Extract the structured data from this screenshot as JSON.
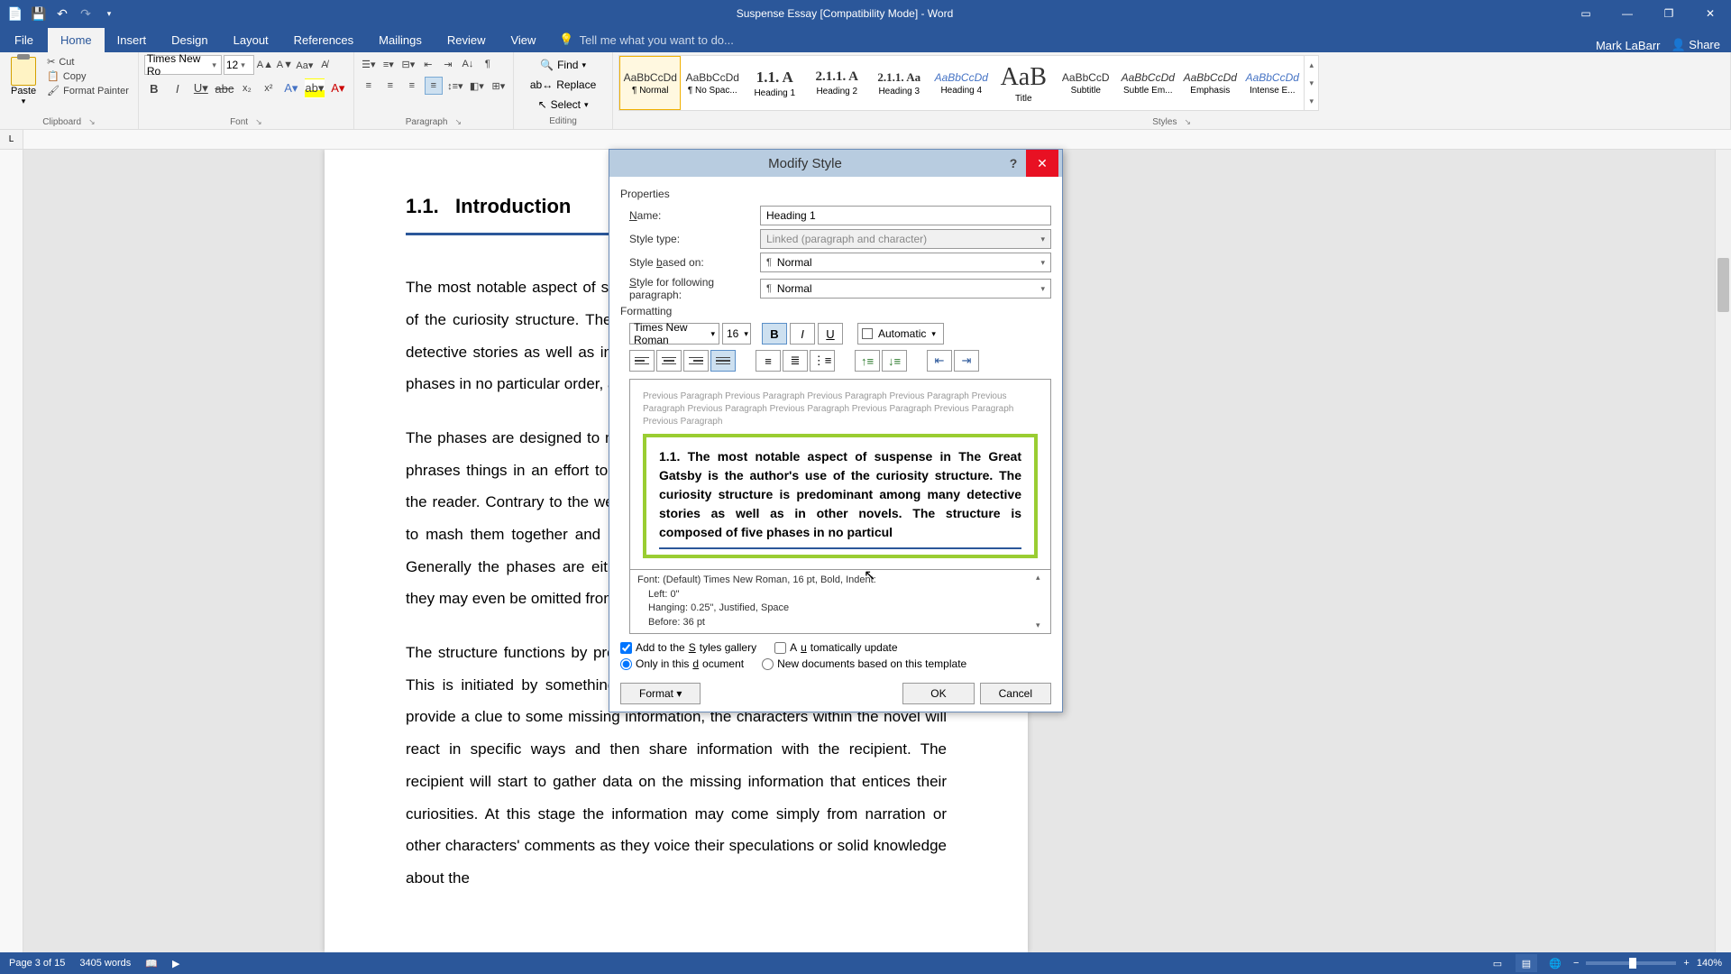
{
  "titlebar": {
    "doc_title": "Suspense Essay [Compatibility Mode] - Word",
    "user": "Mark LaBarr",
    "share": "Share"
  },
  "tabs": {
    "file": "File",
    "home": "Home",
    "insert": "Insert",
    "design": "Design",
    "layout": "Layout",
    "references": "References",
    "mailings": "Mailings",
    "review": "Review",
    "view": "View",
    "tellme": "Tell me what you want to do..."
  },
  "ribbon": {
    "clipboard": {
      "paste": "Paste",
      "cut": "Cut",
      "copy": "Copy",
      "painter": "Format Painter",
      "label": "Clipboard"
    },
    "font": {
      "name": "Times New Ro",
      "size": "12",
      "label": "Font"
    },
    "paragraph": {
      "label": "Paragraph"
    },
    "editing": {
      "find": "Find",
      "replace": "Replace",
      "select": "Select",
      "label": "Editing"
    },
    "styles": {
      "label": "Styles",
      "items": [
        {
          "preview": "AaBbCcDd",
          "name": "¶ Normal",
          "cls": ""
        },
        {
          "preview": "AaBbCcDd",
          "name": "¶ No Spac...",
          "cls": ""
        },
        {
          "preview": "1.1.  A",
          "name": "Heading 1",
          "cls": "h1"
        },
        {
          "preview": "2.1.1.   A",
          "name": "Heading 2",
          "cls": "h2"
        },
        {
          "preview": "2.1.1.  Aa",
          "name": "Heading 3",
          "cls": "h3"
        },
        {
          "preview": "AaBbCcDd",
          "name": "Heading 4",
          "cls": "blue ital"
        },
        {
          "preview": "AaB",
          "name": "Title",
          "cls": "title"
        },
        {
          "preview": "AaBbCcD",
          "name": "Subtitle",
          "cls": ""
        },
        {
          "preview": "AaBbCcDd",
          "name": "Subtle Em...",
          "cls": "ital"
        },
        {
          "preview": "AaBbCcDd",
          "name": "Emphasis",
          "cls": "ital"
        },
        {
          "preview": "AaBbCcDd",
          "name": "Intense E...",
          "cls": "blue ital"
        }
      ]
    }
  },
  "document": {
    "heading_num": "1.1.",
    "heading": "Introduction",
    "p1": "The most notable aspect of suspense in The Great Gatsby is the author's use of the curiosity structure. The curiosity structure is predominant among many detective stories as well as in other novels. The structure is composed of five phases in no particular order, and uses them as guidelines.",
    "p2": "The phases are designed to mark distinct points where the author intentionally phrases things in an effort to bring about curiosity and ultimately suspense in the reader. Contrary to the well-defined nature of the phases, the author tends to mash them together and use them very loosely in the novel as a whole. Generally the phases are either combined with others into single phrases or they may even be omitted from the novel.",
    "p3": "The structure functions by provoking curiosity in an effort to create suspense. This is initiated by something to be curious about. Typically, the author will provide a clue to some missing information, the characters within the novel will react in specific ways and then share information with the recipient. The recipient will start to gather data on the missing information that entices their curiosities. At this stage the information may come simply from narration or other characters' comments as they voice their speculations or solid knowledge about the"
  },
  "status": {
    "page": "Page 3 of 15",
    "words": "3405 words",
    "zoom": "140%"
  },
  "dialog": {
    "title": "Modify Style",
    "properties": "Properties",
    "name_label": "Name:",
    "name_value": "Heading 1",
    "type_label": "Style type:",
    "type_value": "Linked (paragraph and character)",
    "based_label": "Style based on:",
    "based_value": "Normal",
    "following_label": "Style for following paragraph:",
    "following_value": "Normal",
    "formatting": "Formatting",
    "font": "Times New Roman",
    "size": "16",
    "color": "Automatic",
    "prev_para": "Previous Paragraph Previous Paragraph Previous Paragraph Previous Paragraph Previous Paragraph Previous Paragraph Previous Paragraph Previous Paragraph Previous Paragraph Previous Paragraph",
    "sample": "1.1.  The most notable aspect of suspense in The Great Gatsby is the author's use of the curiosity structure. The curiosity structure is predominant among many detective stories as well as in other novels. The structure is composed of five phases in no particul",
    "desc1": "Font: (Default) Times New Roman, 16 pt, Bold, Indent:",
    "desc2": "Left:  0\"",
    "desc3": "Hanging:  0.25\", Justified, Space",
    "desc4": "Before:  36 pt",
    "add_gallery": "Add to the Styles gallery",
    "auto_update": "Automatically update",
    "only_doc": "Only in this document",
    "new_docs": "New documents based on this template",
    "format": "Format",
    "ok": "OK",
    "cancel": "Cancel"
  }
}
